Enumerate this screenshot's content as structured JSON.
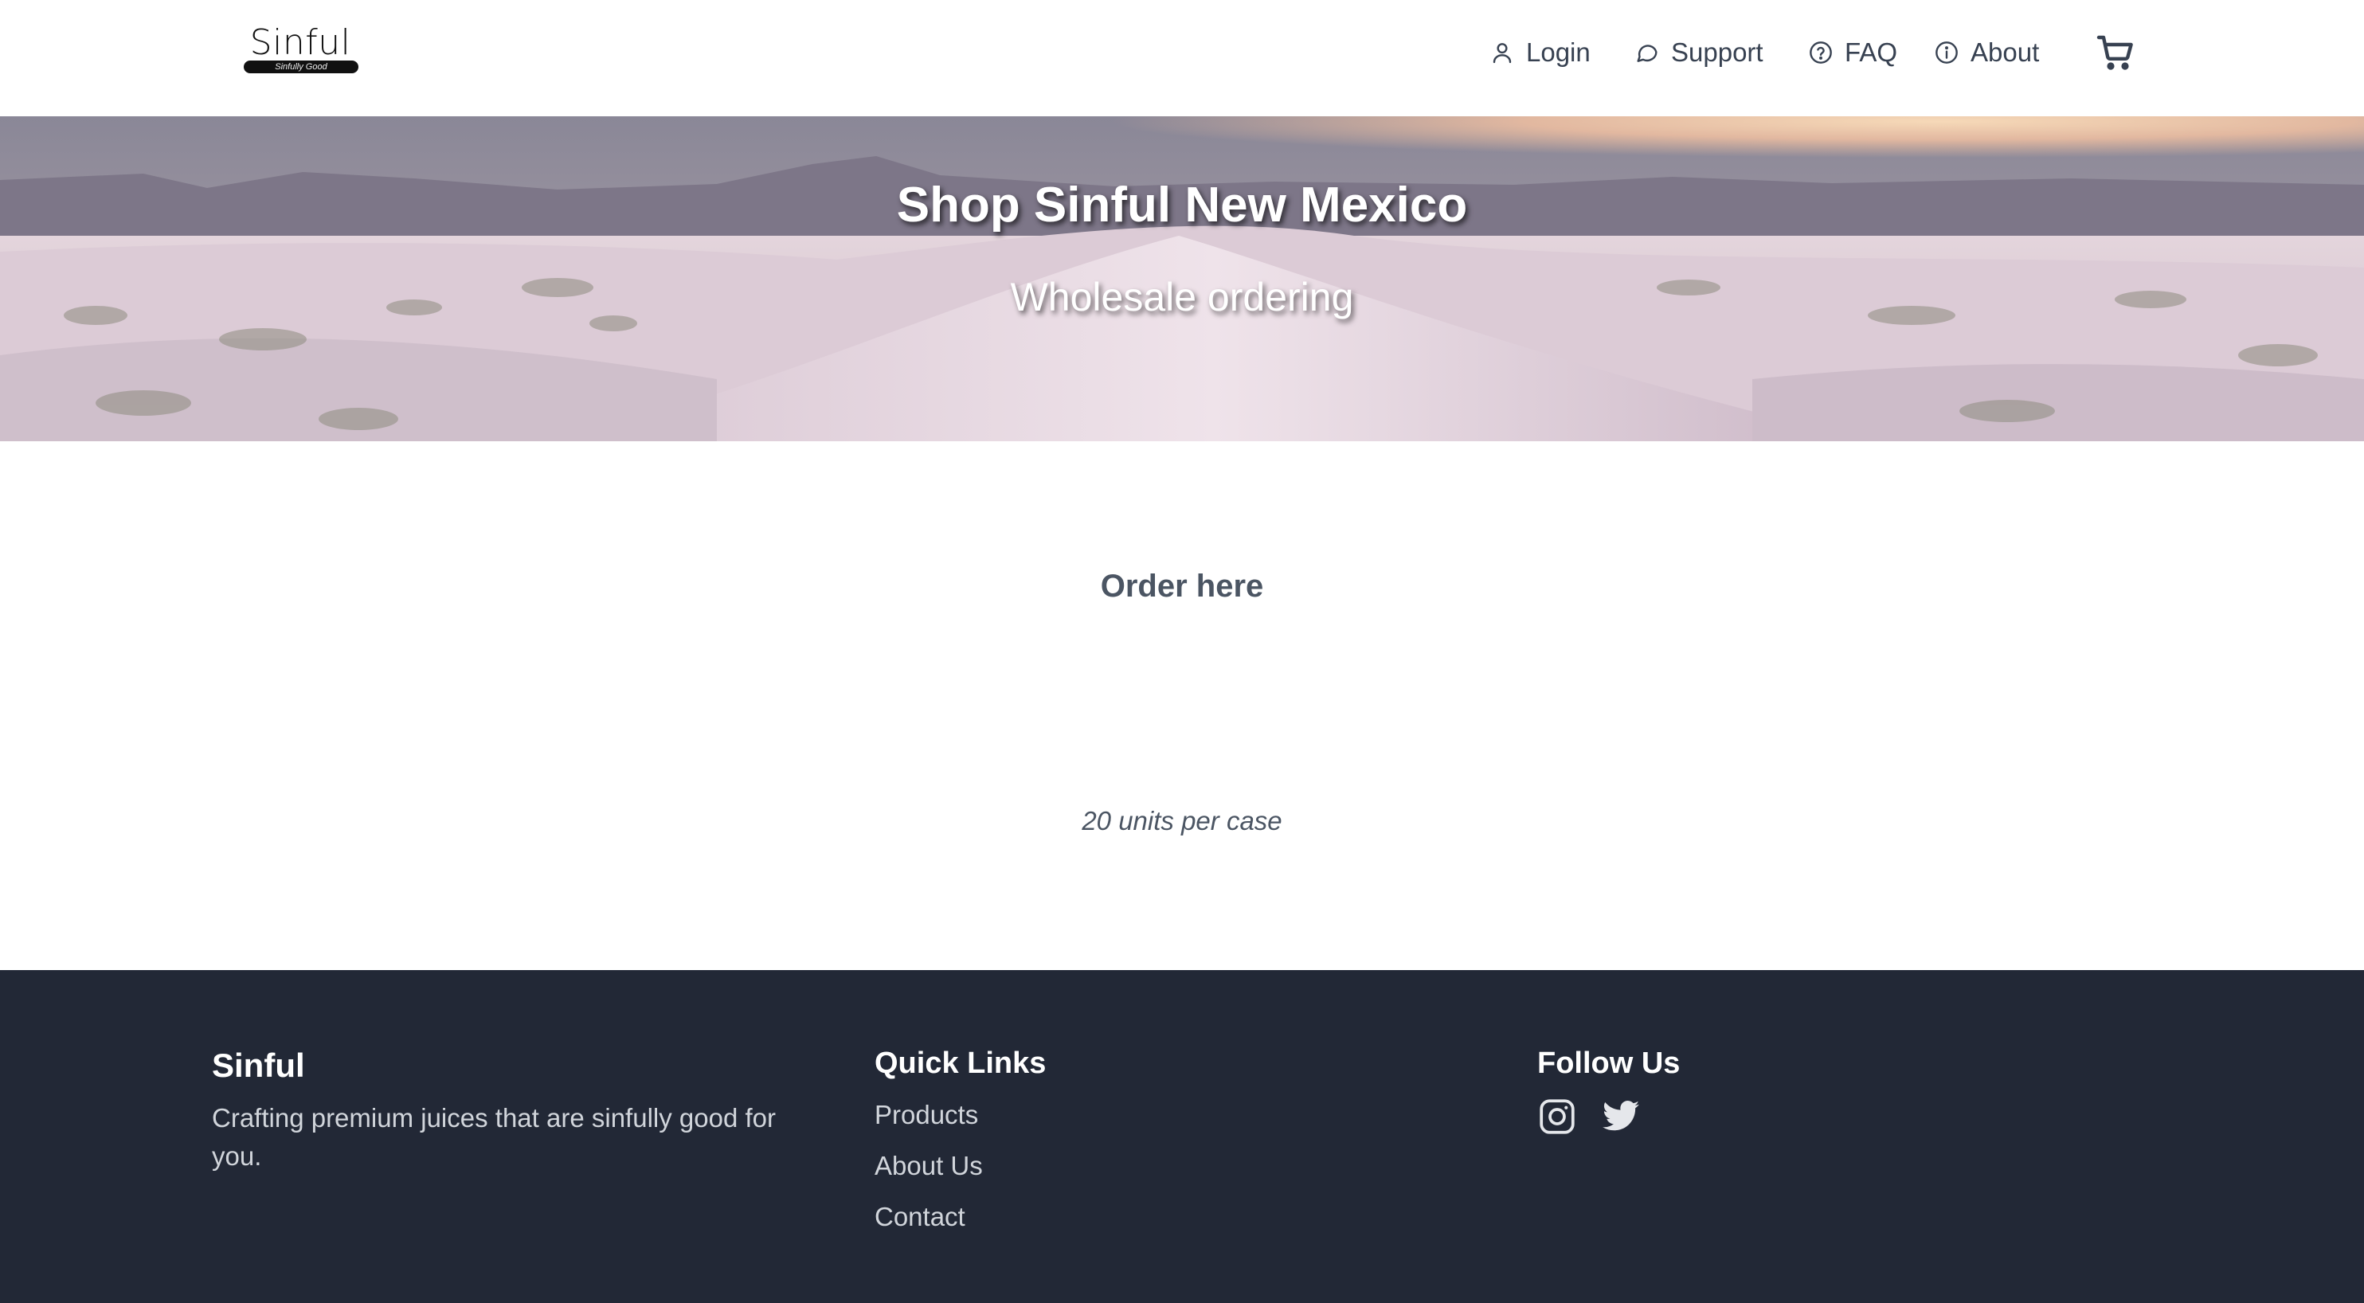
{
  "brand": {
    "logo_text": "Sinful",
    "logo_tagline": "Sinfully Good"
  },
  "nav": {
    "login": "Login",
    "support": "Support",
    "faq": "FAQ",
    "about": "About",
    "cart_icon": "cart-icon"
  },
  "hero": {
    "title": "Shop Sinful New Mexico",
    "subtitle": "Wholesale ordering"
  },
  "main": {
    "order_heading": "Order here",
    "case_note": "20 units per case"
  },
  "footer": {
    "brand": {
      "heading": "Sinful",
      "text": "Crafting premium juices that are sinfully good for you."
    },
    "quick_links": {
      "heading": "Quick Links",
      "items": [
        "Products",
        "About Us",
        "Contact"
      ]
    },
    "follow": {
      "heading": "Follow Us",
      "icons": [
        "instagram-icon",
        "twitter-icon"
      ]
    }
  },
  "colors": {
    "footer_bg": "#222836",
    "text": "#374151"
  }
}
